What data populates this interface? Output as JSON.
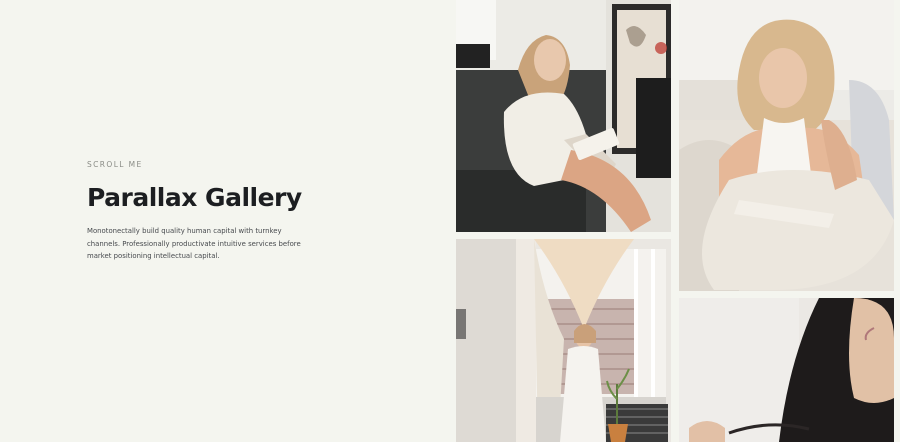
{
  "hero": {
    "eyebrow": "SCROLL ME",
    "title": "Parallax Gallery",
    "description": "Monotonectally build quality human capital with turnkey channels. Professionally productivate intuitive services before market positioning intellectual capital."
  },
  "colors": {
    "background": "#f4f5ef",
    "title": "#1c1e21",
    "body_text": "#474a4e",
    "eyebrow": "#8a8c86"
  },
  "gallery": {
    "images": [
      {
        "icon": "photo-woman-reading-on-sofa"
      },
      {
        "icon": "photo-woman-lounging-in-armchair"
      },
      {
        "icon": "photo-woman-by-window-curtains"
      },
      {
        "icon": "photo-woman-dark-hair-closeup"
      }
    ]
  }
}
